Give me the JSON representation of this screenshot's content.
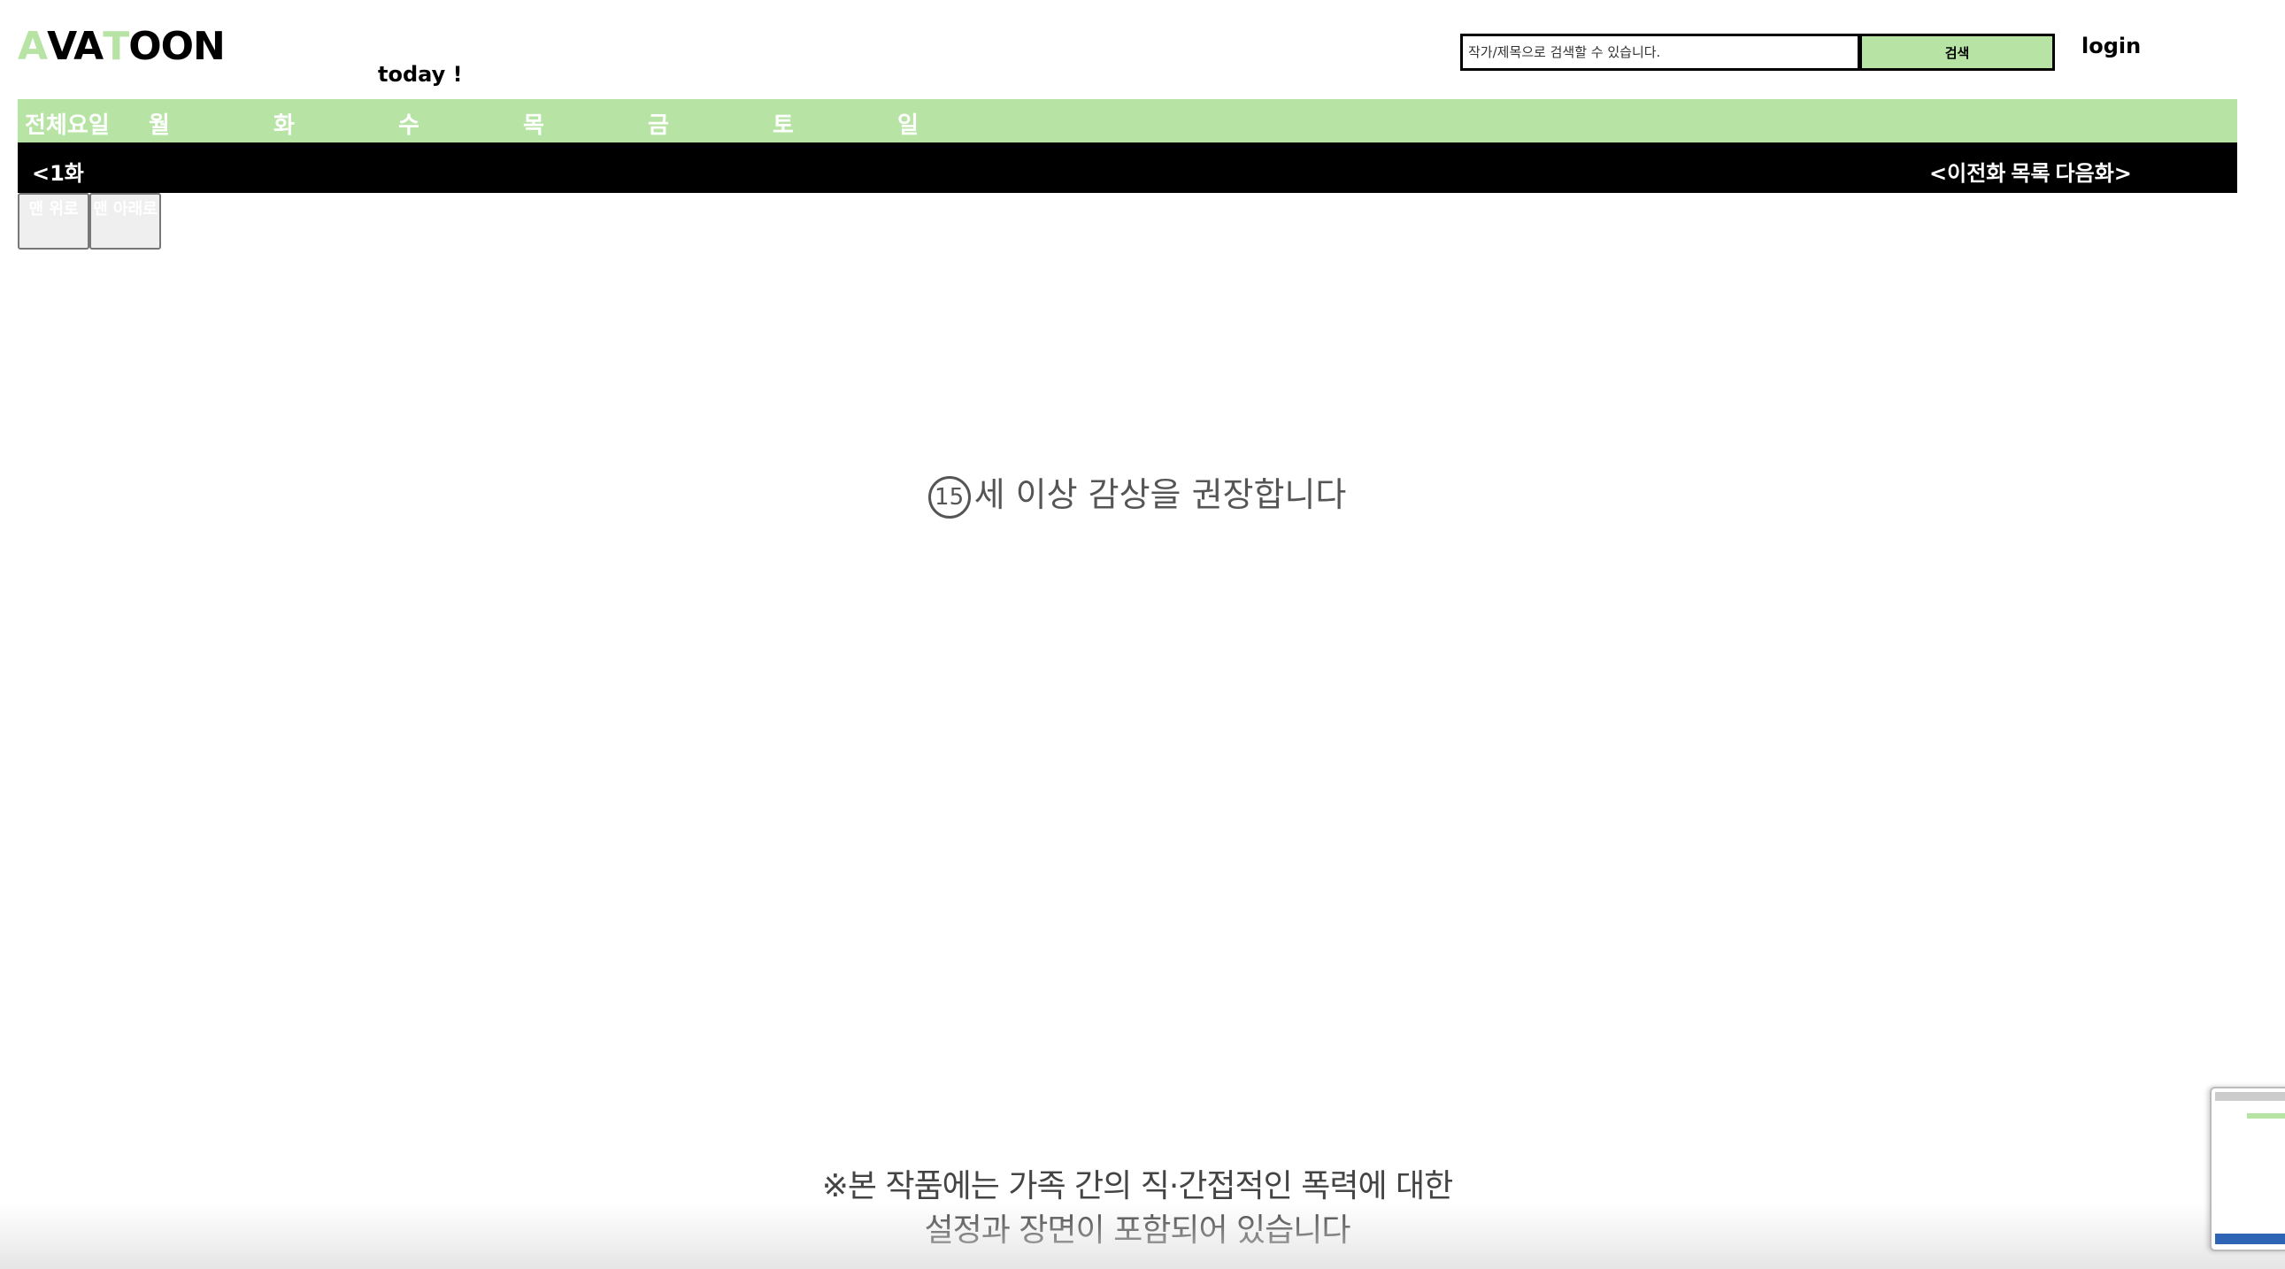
{
  "header": {
    "logo": {
      "letters": [
        "A",
        "VA",
        "T",
        "OON"
      ],
      "accent_color": "#b7e4a5"
    },
    "today_label": "today !",
    "search": {
      "placeholder": "작가/제목으로 검색할 수 있습니다.",
      "button_label": "검색"
    },
    "login_label": "login"
  },
  "day_nav": {
    "items": [
      "전체요일",
      "월",
      "화",
      "수",
      "목",
      "금",
      "토",
      "일"
    ]
  },
  "episode_bar": {
    "title": "<1화",
    "prev_label": "<이전화",
    "list_label": "목록",
    "next_label": "다음화>"
  },
  "small_buttons": {
    "top_label": "맨 위로",
    "bottom_label": "맨 아래로"
  },
  "content": {
    "age_number": "15",
    "age_text": "세 이상 감상을 권장합니다",
    "warning_line1": "※본 작품에는 가족 간의 직·간접적인 폭력에 대한",
    "warning_line2": "설정과 장면이 포함되어 있습니다"
  },
  "colors": {
    "accent": "#b7e4a5",
    "bar": "#000000"
  }
}
